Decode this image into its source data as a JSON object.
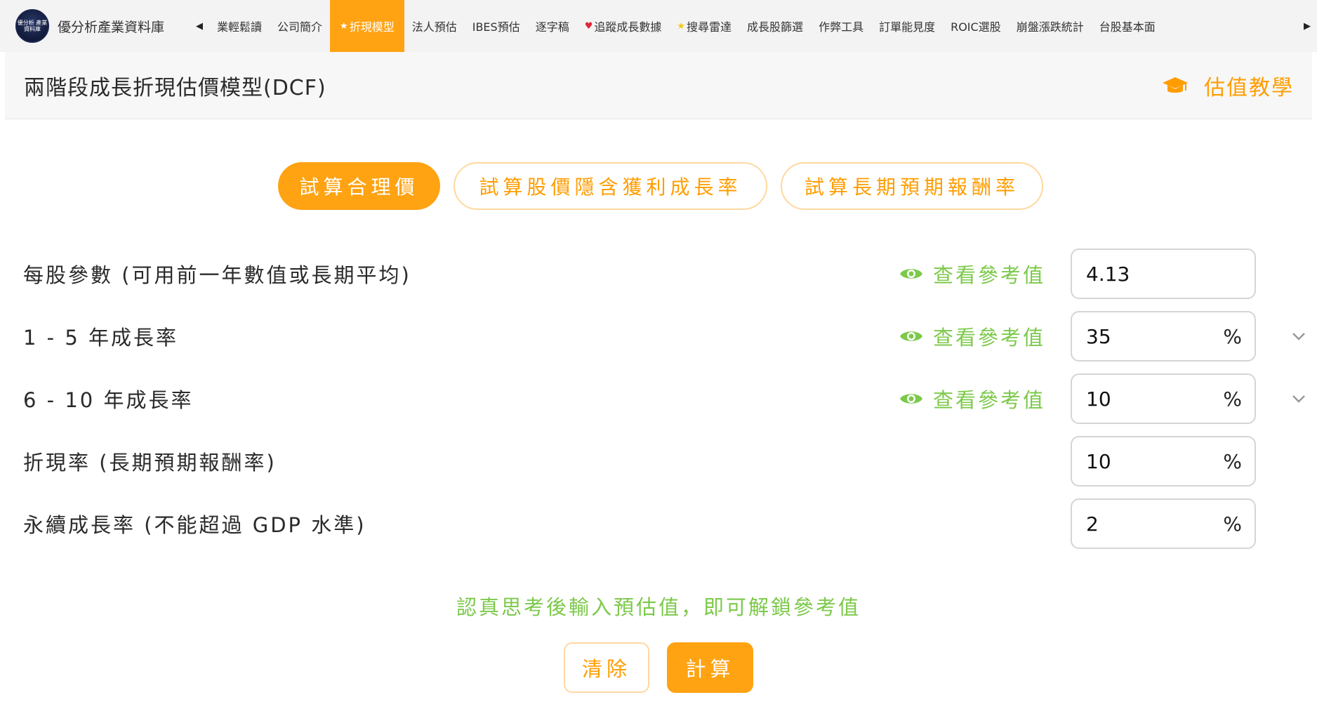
{
  "nav": {
    "brand_name": "優分析產業資料庫",
    "logo_text": "優分析 產業資料庫",
    "items": [
      {
        "label": "業輕鬆讀",
        "prefix": ""
      },
      {
        "label": "公司簡介",
        "prefix": ""
      },
      {
        "label": "折現模型",
        "prefix": "★"
      },
      {
        "label": "法人預估",
        "prefix": ""
      },
      {
        "label": "IBES預估",
        "prefix": ""
      },
      {
        "label": "逐字稿",
        "prefix": ""
      },
      {
        "label": "追蹤成長數據",
        "prefix": "♥"
      },
      {
        "label": "搜尋雷達",
        "prefix": "★"
      },
      {
        "label": "成長股篩選",
        "prefix": ""
      },
      {
        "label": "作弊工具",
        "prefix": ""
      },
      {
        "label": "訂單能見度",
        "prefix": ""
      },
      {
        "label": "ROIC選股",
        "prefix": ""
      },
      {
        "label": "崩盤漲跌統計",
        "prefix": ""
      },
      {
        "label": "台股基本面",
        "prefix": ""
      }
    ],
    "active_index": 2
  },
  "header": {
    "title": "兩階段成長折現估價模型(DCF)",
    "tutorial_label": "估值教學"
  },
  "modes": {
    "fair_value": "試算合理價",
    "implied_growth": "試算股價隱含獲利成長率",
    "expected_return": "試算長期預期報酬率"
  },
  "form": {
    "ref_link_label": "查看參考值",
    "rows": [
      {
        "label": "每股參數 (可用前一年數值或長期平均)",
        "value": "4.13",
        "unit": "",
        "has_ref": true,
        "has_dropdown": false
      },
      {
        "label": "1 - 5 年成長率",
        "value": "35",
        "unit": "%",
        "has_ref": true,
        "has_dropdown": true
      },
      {
        "label": "6 - 10 年成長率",
        "value": "10",
        "unit": "%",
        "has_ref": true,
        "has_dropdown": true
      },
      {
        "label": "折現率 (長期預期報酬率)",
        "value": "10",
        "unit": "%",
        "has_ref": false,
        "has_dropdown": false
      },
      {
        "label": "永續成長率 (不能超過 GDP 水準)",
        "value": "2",
        "unit": "%",
        "has_ref": false,
        "has_dropdown": false
      }
    ]
  },
  "footer": {
    "hint": "認真思考後輸入預估值，即可解鎖參考值",
    "clear_label": "清除",
    "calculate_label": "計算"
  },
  "colors": {
    "accent": "#ffa313",
    "accent_text": "#ff9d00",
    "green": "#7cc94a"
  }
}
